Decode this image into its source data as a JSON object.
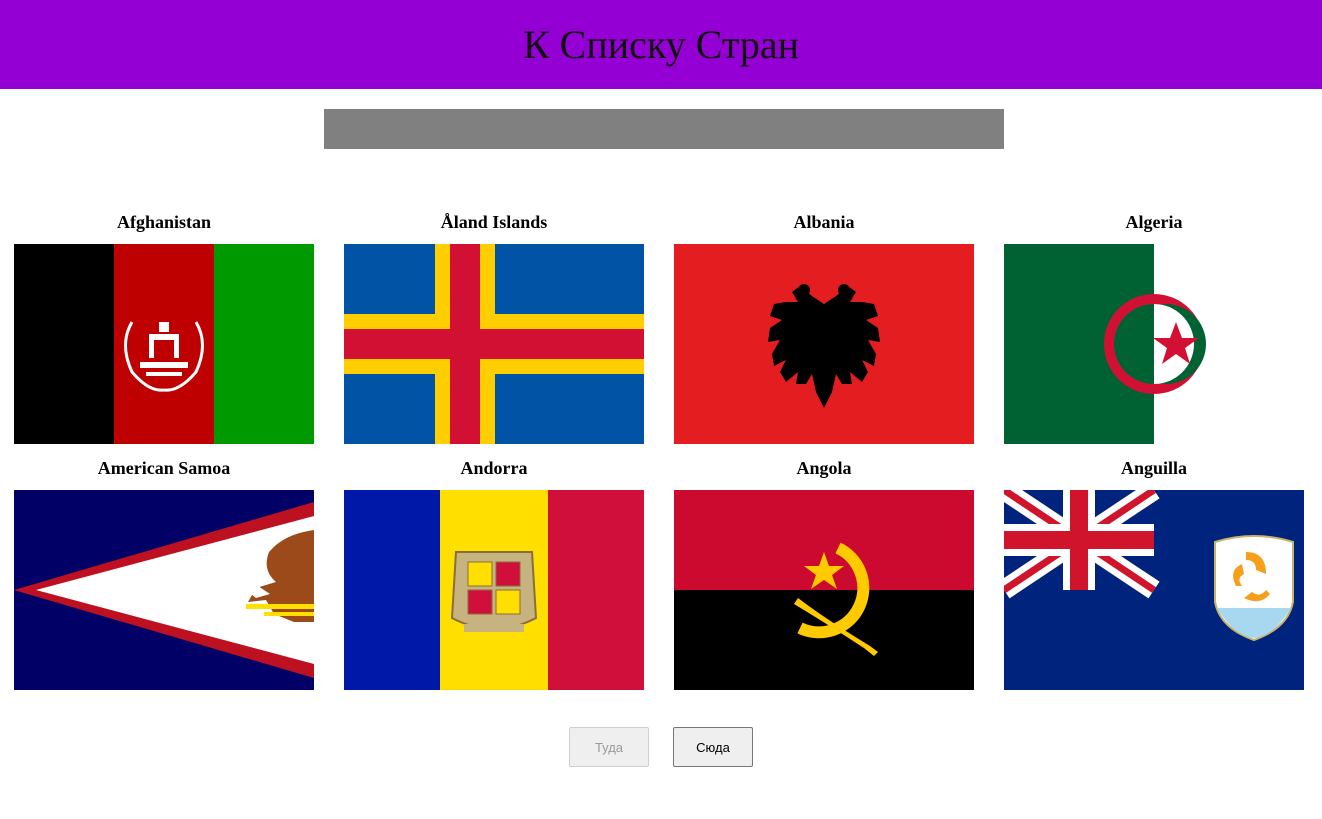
{
  "header": {
    "title": "К Списку Стран",
    "bg_color": "#9400d3"
  },
  "search": {
    "value": "",
    "placeholder": "",
    "bg_color": "#808080"
  },
  "countries": [
    {
      "name": "Afghanistan"
    },
    {
      "name": "Åland Islands"
    },
    {
      "name": "Albania"
    },
    {
      "name": "Algeria"
    },
    {
      "name": "American Samoa"
    },
    {
      "name": "Andorra"
    },
    {
      "name": "Angola"
    },
    {
      "name": "Anguilla"
    }
  ],
  "pagination": {
    "prev_label": "Туда",
    "next_label": "Сюда",
    "prev_disabled": true
  }
}
